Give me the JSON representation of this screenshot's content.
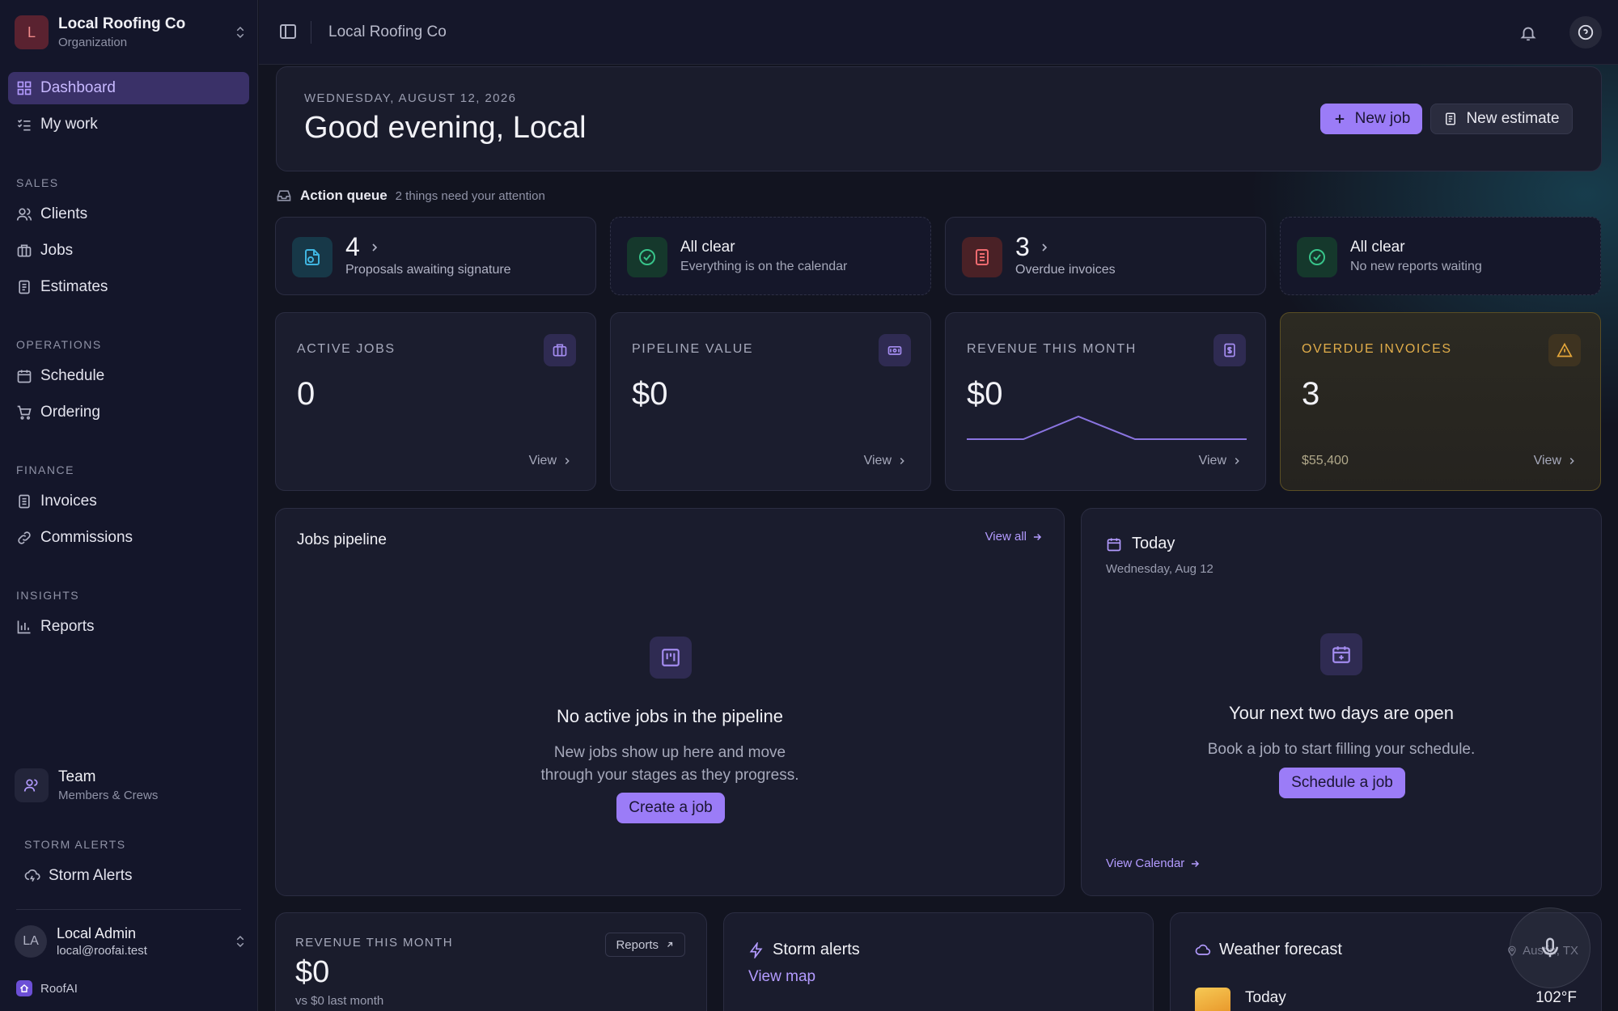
{
  "sidebar": {
    "org": {
      "initial": "L",
      "name": "Local Roofing Co",
      "type": "Organization"
    },
    "primary": [
      {
        "label": "Dashboard",
        "icon": "dashboard-icon",
        "active": true
      },
      {
        "label": "My work",
        "icon": "checklist-icon"
      }
    ],
    "sections": {
      "sales": {
        "title": "SALES",
        "items": [
          "Clients",
          "Jobs",
          "Estimates"
        ]
      },
      "operations": {
        "title": "OPERATIONS",
        "items": [
          "Schedule",
          "Ordering"
        ]
      },
      "finance": {
        "title": "FINANCE",
        "items": [
          "Invoices",
          "Commissions"
        ]
      },
      "insights": {
        "title": "INSIGHTS",
        "items": [
          "Reports"
        ]
      }
    },
    "team": {
      "title": "Team",
      "subtitle": "Members & Crews"
    },
    "storm_section": {
      "title": "STORM ALERTS",
      "item": "Storm Alerts"
    },
    "user": {
      "initials": "LA",
      "name": "Local Admin",
      "email": "local@roofai.test"
    },
    "brand": "RoofAI"
  },
  "topbar": {
    "title": "Local Roofing Co"
  },
  "greeting": {
    "date": "WEDNESDAY, AUGUST 12, 2026",
    "title": "Good evening, Local",
    "new_job": "New job",
    "new_estimate": "New estimate"
  },
  "action_queue": {
    "title": "Action queue",
    "subtitle": "2 things need your attention",
    "cards": [
      {
        "value": "4",
        "label": "Proposals awaiting signature",
        "icon": "signature-icon",
        "color": "#2a8fb0"
      },
      {
        "title": "All clear",
        "label": "Everything is on the calendar",
        "icon": "check-circle-icon",
        "color": "#2fb57a"
      },
      {
        "value": "3",
        "label": "Overdue invoices",
        "icon": "invoice-icon",
        "color": "#e0565b"
      },
      {
        "title": "All clear",
        "label": "No new reports waiting",
        "icon": "check-circle-icon",
        "color": "#2fb57a"
      }
    ]
  },
  "stats": [
    {
      "label": "ACTIVE JOBS",
      "value": "0",
      "view": "View",
      "icon": "briefcase-icon"
    },
    {
      "label": "PIPELINE VALUE",
      "value": "$0",
      "view": "View",
      "icon": "cash-icon"
    },
    {
      "label": "REVENUE THIS MONTH",
      "value": "$0",
      "view": "View",
      "icon": "receipt-icon"
    },
    {
      "label": "OVERDUE INVOICES",
      "value": "3",
      "sub": "$55,400",
      "view": "View",
      "icon": "warning-icon"
    }
  ],
  "pipeline": {
    "title": "Jobs pipeline",
    "view_all": "View all",
    "empty_title": "No active jobs in the pipeline",
    "empty_line1": "New jobs show up here and move",
    "empty_line2": "through your stages as they progress.",
    "cta": "Create a job"
  },
  "today": {
    "title": "Today",
    "date": "Wednesday, Aug 12",
    "empty_title": "Your next two days are open",
    "empty_body": "Book a job to start filling your schedule.",
    "cta": "Schedule a job",
    "link": "View Calendar"
  },
  "revenue_card": {
    "label": "REVENUE THIS MONTH",
    "button": "Reports",
    "value": "$0",
    "sub": "vs $0 last month"
  },
  "storm_card": {
    "title": "Storm alerts",
    "link": "View map"
  },
  "weather": {
    "title": "Weather forecast",
    "location": "Austin, TX",
    "day": "Today",
    "temp": "102°F"
  },
  "colors": {
    "accent": "#9b7cf7",
    "warning": "#e1ad4a",
    "danger": "#e0565b",
    "success": "#2fb57a"
  }
}
